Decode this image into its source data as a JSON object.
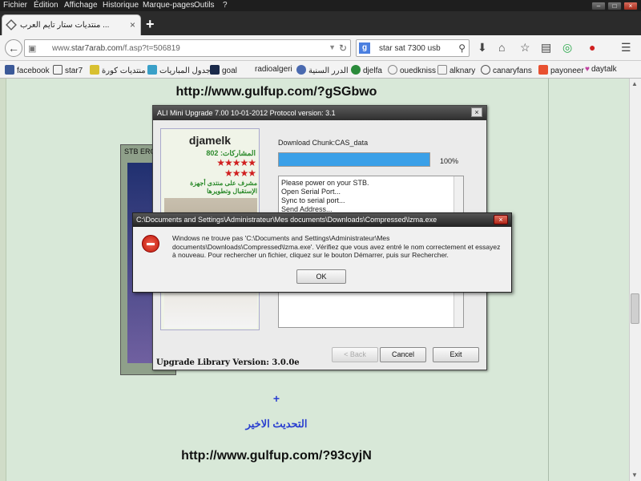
{
  "menu": [
    "Fichier",
    "Édition",
    "Affichage",
    "Historique",
    "Marque-pages",
    "Outils",
    "?"
  ],
  "window_controls": {
    "minimize": "–",
    "maximize": "□",
    "close": "×"
  },
  "tab": {
    "title": "منتديات ستار تايم العرب ...",
    "close": "×"
  },
  "new_tab": "+",
  "url": {
    "prefix": "www.",
    "domain": "star7arab.com",
    "path": "/f.asp?t=506819"
  },
  "search": {
    "engine": "g",
    "query": "star sat 7300 usb"
  },
  "bookmarks": [
    "facebook",
    "star7",
    "منتديات كورة",
    "جدول المباريات",
    "goal",
    "radioalgeri",
    "الدرر السنية",
    "djelfa",
    "ouedkniss",
    "alknary",
    "canaryfans",
    "payoneer",
    "daytalk"
  ],
  "page": {
    "link_top": "http://www.gulfup.com/?gSGbwo",
    "plus": "+",
    "arabic_heading": "التحديث الاخير",
    "link_bottom": "http://www.gulfup.com/?93cyjN"
  },
  "stb_window": {
    "title": "STB ERO"
  },
  "ali_dialog": {
    "title": "ALI Mini Upgrade 7.00   10-01-2012 Protocol version: 3.1",
    "close": "×",
    "user": {
      "name": "djamelk",
      "posts": "المشاركات: 802",
      "star_rows": [
        "★★★★★",
        "★★★★"
      ],
      "role": "مشرف على منتدى أجهزة الإستقبال وتطويرها"
    },
    "download_label": "Download Chunk:CAS_data",
    "progress": 100,
    "progress_text": "100%",
    "log_lines": [
      "Please power on your STB.",
      "Open Serial Port...",
      "Sync to serial port...",
      "Send Address..."
    ],
    "buttons": {
      "back": "< Back",
      "cancel": "Cancel",
      "exit": "Exit"
    },
    "library_version": "Upgrade Library Version: 3.0.0e"
  },
  "error_dialog": {
    "title": "C:\\Documents and Settings\\Administrateur\\Mes documents\\Downloads\\Compressed\\lzma.exe",
    "close": "×",
    "message": "Windows ne trouve pas 'C:\\Documents and Settings\\Administrateur\\Mes documents\\Downloads\\Compressed\\lzma.exe'. Vérifiez que vous avez entré le nom correctement et essayez à nouveau. Pour rechercher un fichier, cliquez sur le bouton Démarrer, puis sur Rechercher.",
    "ok": "OK"
  },
  "colors": {
    "page_bg": "#d8e8d8",
    "progress": "#3aa0e8",
    "link_blue": "#2a3fd0",
    "stars": "#d02020"
  }
}
